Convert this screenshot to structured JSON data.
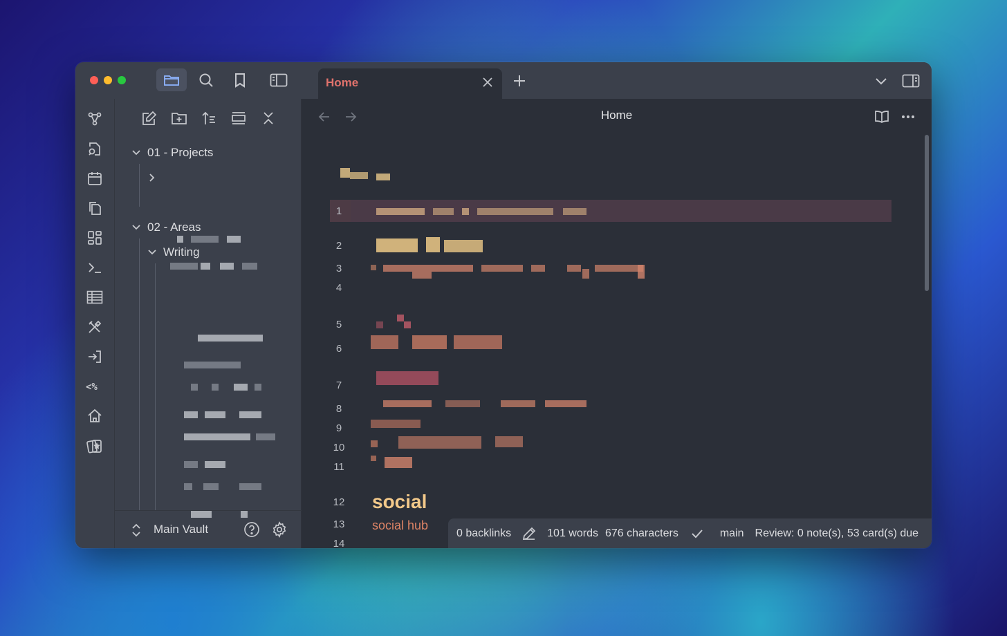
{
  "tab": {
    "title": "Home"
  },
  "view": {
    "title": "Home"
  },
  "explorer": {
    "folders": [
      {
        "label": "01 - Projects"
      },
      {
        "label": "02 - Areas"
      },
      {
        "label": "Writing"
      }
    ]
  },
  "vault": {
    "name": "Main Vault"
  },
  "editor": {
    "line_numbers": [
      "1",
      "2",
      "3",
      "4",
      "5",
      "6",
      "7",
      "8",
      "9",
      "10",
      "11",
      "12",
      "13",
      "14"
    ],
    "heading": "social",
    "subline": "social hub"
  },
  "status": {
    "backlinks": "0 backlinks",
    "words": "101 words",
    "characters": "676 characters",
    "branch": "main",
    "review": "Review: 0 note(s), 53 card(s) due"
  },
  "colors": {
    "accent": "#8fb4ff",
    "tab_title": "#e0726c",
    "heading": "#f3c98a",
    "link": "#de8466"
  },
  "icons": [
    "folder-icon",
    "search-icon",
    "bookmark-icon",
    "sidebar-toggle-icon",
    "close-icon",
    "plus-icon",
    "chevron-down-icon",
    "right-sidebar-icon",
    "graph-icon",
    "file-search-icon",
    "calendar-icon",
    "copy-icon",
    "dashboard-icon",
    "terminal-icon",
    "table-icon",
    "tools-icon",
    "import-icon",
    "template-icon",
    "home-icon",
    "flashcards-icon",
    "new-note-icon",
    "new-folder-icon",
    "sort-icon",
    "collapse-icon",
    "close-all-icon",
    "arrow-left-icon",
    "arrow-right-icon",
    "reading-mode-icon",
    "more-options-icon",
    "pencil-icon",
    "check-icon",
    "help-icon",
    "settings-icon",
    "vault-switch-icon"
  ]
}
